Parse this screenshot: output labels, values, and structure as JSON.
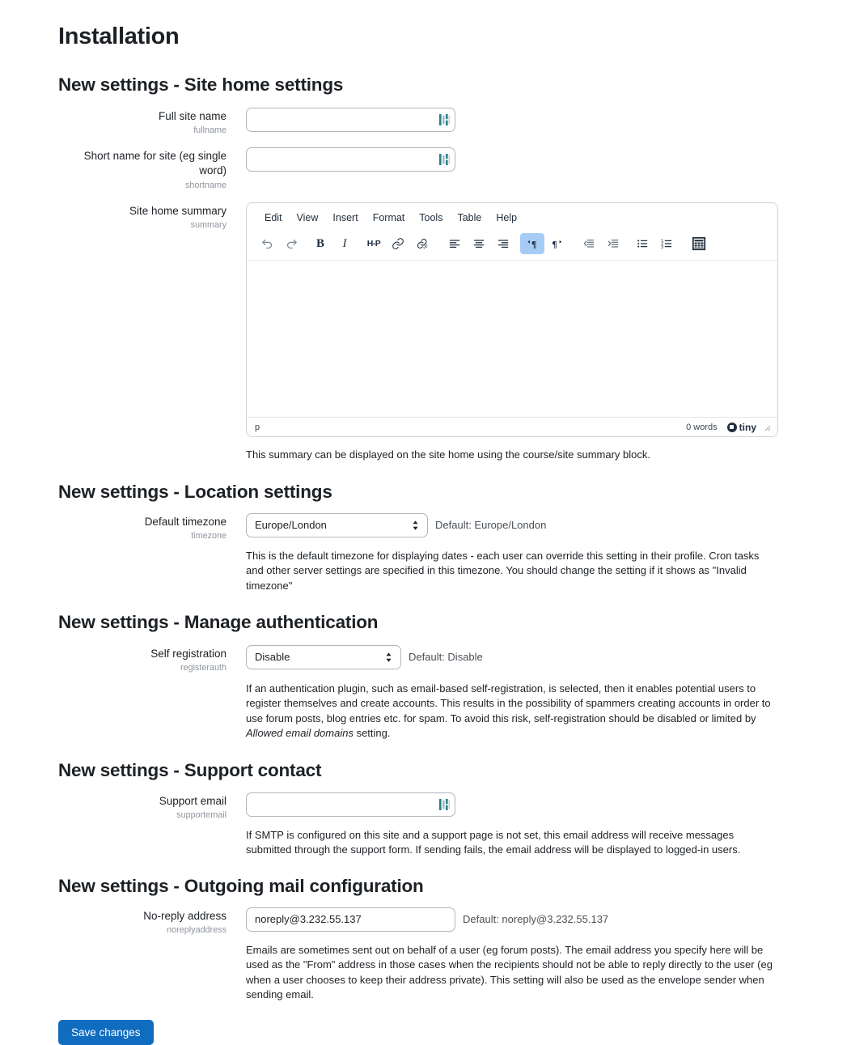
{
  "page": {
    "title": "Installation",
    "save_label": "Save changes"
  },
  "sections": [
    {
      "heading": "New settings - Site home settings",
      "fields": [
        {
          "label": "Full site name",
          "key": "fullname",
          "type": "text",
          "value": "",
          "icon": "autofill-icon"
        },
        {
          "label": "Short name for site (eg single word)",
          "key": "shortname",
          "type": "text",
          "value": "",
          "icon": "autofill-icon"
        },
        {
          "label": "Site home summary",
          "key": "summary",
          "type": "editor",
          "help": "This summary can be displayed on the site home using the course/site summary block."
        }
      ]
    },
    {
      "heading": "New settings - Location settings",
      "fields": [
        {
          "label": "Default timezone",
          "key": "timezone",
          "type": "select",
          "value": "Europe/London",
          "default_note": "Default: Europe/London",
          "help": "This is the default timezone for displaying dates - each user can override this setting in their profile. Cron tasks and other server settings are specified in this timezone. You should change the setting if it shows as \"Invalid timezone\""
        }
      ]
    },
    {
      "heading": "New settings - Manage authentication",
      "fields": [
        {
          "label": "Self registration",
          "key": "registerauth",
          "type": "select",
          "value": "Disable",
          "default_note": "Default: Disable",
          "help_parts": {
            "a": "If an authentication plugin, such as email-based self-registration, is selected, then it enables potential users to register themselves and create accounts. This results in the possibility of spammers creating accounts in order to use forum posts, blog entries etc. for spam. To avoid this risk, self-registration should be disabled or limited by ",
            "em": "Allowed email domains",
            "b": " setting."
          }
        }
      ]
    },
    {
      "heading": "New settings - Support contact",
      "fields": [
        {
          "label": "Support email",
          "key": "supportemail",
          "type": "text",
          "value": "",
          "icon": "autofill-icon",
          "help": "If SMTP is configured on this site and a support page is not set, this email address will receive messages submitted through the support form. If sending fails, the email address will be displayed to logged-in users."
        }
      ]
    },
    {
      "heading": "New settings - Outgoing mail configuration",
      "fields": [
        {
          "label": "No-reply address",
          "key": "noreplyaddress",
          "type": "text",
          "value": "noreply@3.232.55.137",
          "default_note": "Default: noreply@3.232.55.137",
          "help": "Emails are sometimes sent out on behalf of a user (eg forum posts). The email address you specify here will be used as the \"From\" address in those cases when the recipients should not be able to reply directly to the user (eg when a user chooses to keep their address private). This setting will also be used as the envelope sender when sending email."
        }
      ]
    }
  ],
  "editor": {
    "menu": [
      "Edit",
      "View",
      "Insert",
      "Format",
      "Tools",
      "Table",
      "Help"
    ],
    "toolbar": [
      {
        "name": "undo-icon",
        "label": "Undo",
        "active": false
      },
      {
        "name": "redo-icon",
        "label": "Redo",
        "active": false
      },
      {
        "name": "bold-icon",
        "label": "Bold",
        "active": false
      },
      {
        "name": "italic-icon",
        "label": "Italic",
        "active": false
      },
      {
        "name": "h5p-icon",
        "label": "H5P",
        "active": false
      },
      {
        "name": "link-icon",
        "label": "Insert/edit link",
        "active": false
      },
      {
        "name": "unlink-icon",
        "label": "Remove link",
        "active": false
      },
      {
        "name": "align-left-icon",
        "label": "Align left",
        "active": false
      },
      {
        "name": "align-center-icon",
        "label": "Align center",
        "active": false
      },
      {
        "name": "align-right-icon",
        "label": "Align right",
        "active": false
      },
      {
        "name": "ltr-icon",
        "label": "Left to right",
        "active": true
      },
      {
        "name": "rtl-icon",
        "label": "Right to left",
        "active": false
      },
      {
        "name": "outdent-icon",
        "label": "Decrease indent",
        "active": false
      },
      {
        "name": "indent-icon",
        "label": "Increase indent",
        "active": false
      },
      {
        "name": "bullet-list-icon",
        "label": "Bullet list",
        "active": false
      },
      {
        "name": "numbered-list-icon",
        "label": "Numbered list",
        "active": false
      },
      {
        "name": "table-icon",
        "label": "Table",
        "active": false
      }
    ],
    "status": {
      "path": "p",
      "words": "0 words",
      "brand": "tiny"
    },
    "content": ""
  },
  "colors": {
    "accent": "#0f6cbf",
    "toolbar_active": "#a6ccf5",
    "autofill_icon": "#3a7d85",
    "muted_text": "#8f959e",
    "border": "#b1b6be"
  }
}
